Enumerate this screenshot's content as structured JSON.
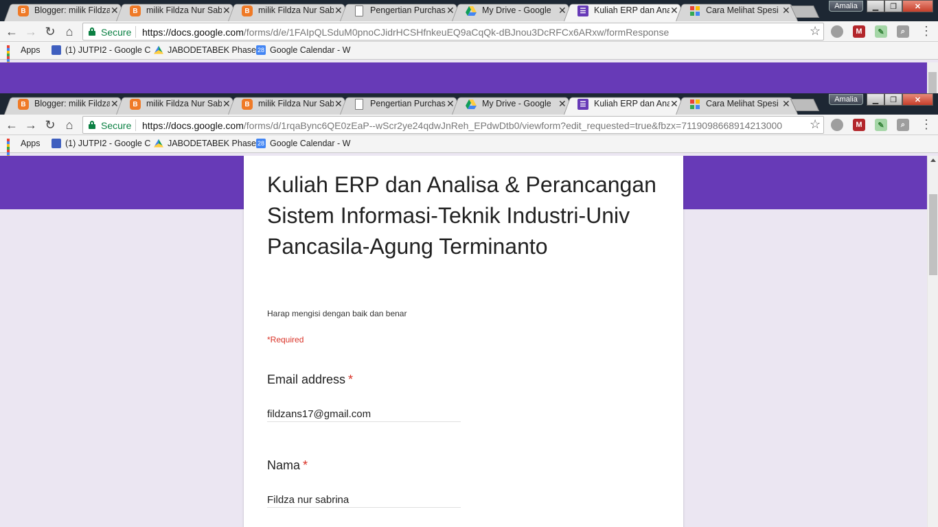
{
  "browser_top": {
    "tabs": [
      {
        "title": "Blogger: milik Fildza",
        "icon": "blogger-icon"
      },
      {
        "title": "milik Fildza Nur Sab",
        "icon": "blogger-icon"
      },
      {
        "title": "milik Fildza Nur Sab",
        "icon": "blogger-icon"
      },
      {
        "title": "Pengertian Purchas",
        "icon": "document-icon"
      },
      {
        "title": "My Drive - Google",
        "icon": "drive-icon"
      },
      {
        "title": "Kuliah ERP dan Ana",
        "icon": "forms-icon",
        "active": true
      },
      {
        "title": "Cara Melihat Spesi",
        "icon": "grid-icon"
      }
    ],
    "profile": "Amalia",
    "secure_label": "Secure",
    "url_host": "https://docs.google.com",
    "url_rest": "/forms/d/e/1FAIpQLSduM0pnoCJidrHCSHfnkeuEQ9aCqQk-dBJnou3DcRFCx6ARxw/formResponse"
  },
  "browser_bottom": {
    "tabs": [
      {
        "title": "Blogger: milik Fildza",
        "icon": "blogger-icon"
      },
      {
        "title": "milik Fildza Nur Sab",
        "icon": "blogger-icon"
      },
      {
        "title": "milik Fildza Nur Sab",
        "icon": "blogger-icon"
      },
      {
        "title": "Pengertian Purchas",
        "icon": "document-icon"
      },
      {
        "title": "My Drive - Google",
        "icon": "drive-icon"
      },
      {
        "title": "Kuliah ERP dan Ana",
        "icon": "forms-icon",
        "active": true
      },
      {
        "title": "Cara Melihat Spesi",
        "icon": "grid-icon"
      }
    ],
    "profile": "Amalia",
    "secure_label": "Secure",
    "url_host": "https://docs.google.com",
    "url_rest": "/forms/d/1rqaBync6QE0zEaP--wScr2ye24qdwJnReh_EPdwDtb0/viewform?edit_requested=true&fbzx=7119098668914213000"
  },
  "bookmarks": [
    {
      "label": "Apps",
      "icon": "apps-grid-icon"
    },
    {
      "label": "(1) JUTPI2 - Google C",
      "icon": "jutpi-icon"
    },
    {
      "label": "JABODETABEK Phase",
      "icon": "drive-icon"
    },
    {
      "label": "Google Calendar - W",
      "icon": "calendar-icon",
      "badge": "28"
    }
  ],
  "form": {
    "title": "Kuliah ERP dan Analisa & Perancangan Sistem Informasi-Teknik Industri-Univ Pancasila-Agung Terminanto",
    "description": "Harap mengisi dengan baik dan benar",
    "required_note": "*Required",
    "questions": [
      {
        "label": "Email address",
        "required_mark": "*",
        "answer": "fildzans17@gmail.com"
      },
      {
        "label": "Nama",
        "required_mark": "*",
        "answer": "Fildza nur sabrina"
      }
    ]
  },
  "colors": {
    "accent_purple": "#673ab7",
    "page_background": "#ebe6f2",
    "required_red": "#d93025",
    "secure_green": "#0b8043"
  }
}
